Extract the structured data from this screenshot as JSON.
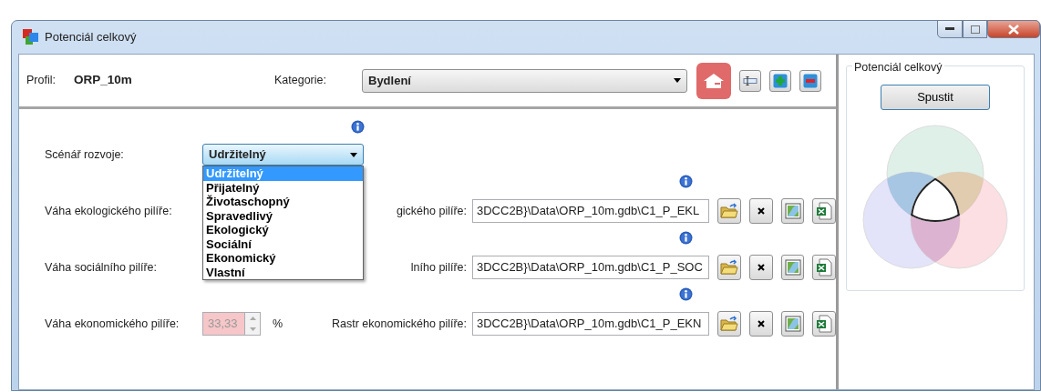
{
  "window": {
    "title": "Potenciál celkový"
  },
  "profile": {
    "label": "Profil:",
    "value": "ORP_10m"
  },
  "category": {
    "label": "Kategorie:",
    "value": "Bydlení"
  },
  "toolbar": [
    {
      "kind": "house",
      "selected": true
    },
    {
      "kind": "rename",
      "selected": false
    },
    {
      "kind": "add",
      "selected": false
    },
    {
      "kind": "remove",
      "selected": false
    }
  ],
  "scenario": {
    "label": "Scénář rozvoje:",
    "value": "Udržitelný",
    "expanded": true,
    "options": [
      {
        "label": "Udržitelný",
        "selected": true
      },
      {
        "label": "Přijatelný",
        "selected": false
      },
      {
        "label": "Životaschopný",
        "selected": false
      },
      {
        "label": "Spravedlivý",
        "selected": false
      },
      {
        "label": "Ekologický",
        "selected": false
      },
      {
        "label": "Sociální",
        "selected": false
      },
      {
        "label": "Ekonomický",
        "selected": false
      },
      {
        "label": "Vlastní",
        "selected": false
      }
    ]
  },
  "pillars": [
    {
      "weight_label": "Váha ekologického pilíře:",
      "raster_label": "gického pilíře:",
      "path": "3DCC2B}\\Data\\ORP_10m.gdb\\C1_P_EKL"
    },
    {
      "weight_label": "Váha sociálního pilíře:",
      "raster_label": "lního pilíře:",
      "path": "3DCC2B}\\Data\\ORP_10m.gdb\\C1_P_SOC"
    },
    {
      "weight_label": "Váha ekonomického pilíře:",
      "weight": {
        "value": "33,33",
        "unit": "%",
        "disabled": true
      },
      "raster_label": "Rastr ekonomického pilíře:",
      "path": "3DCC2B}\\Data\\ORP_10m.gdb\\C1_P_EKN"
    }
  ],
  "run_panel": {
    "title": "Potenciál celkový",
    "button": "Spustit"
  }
}
